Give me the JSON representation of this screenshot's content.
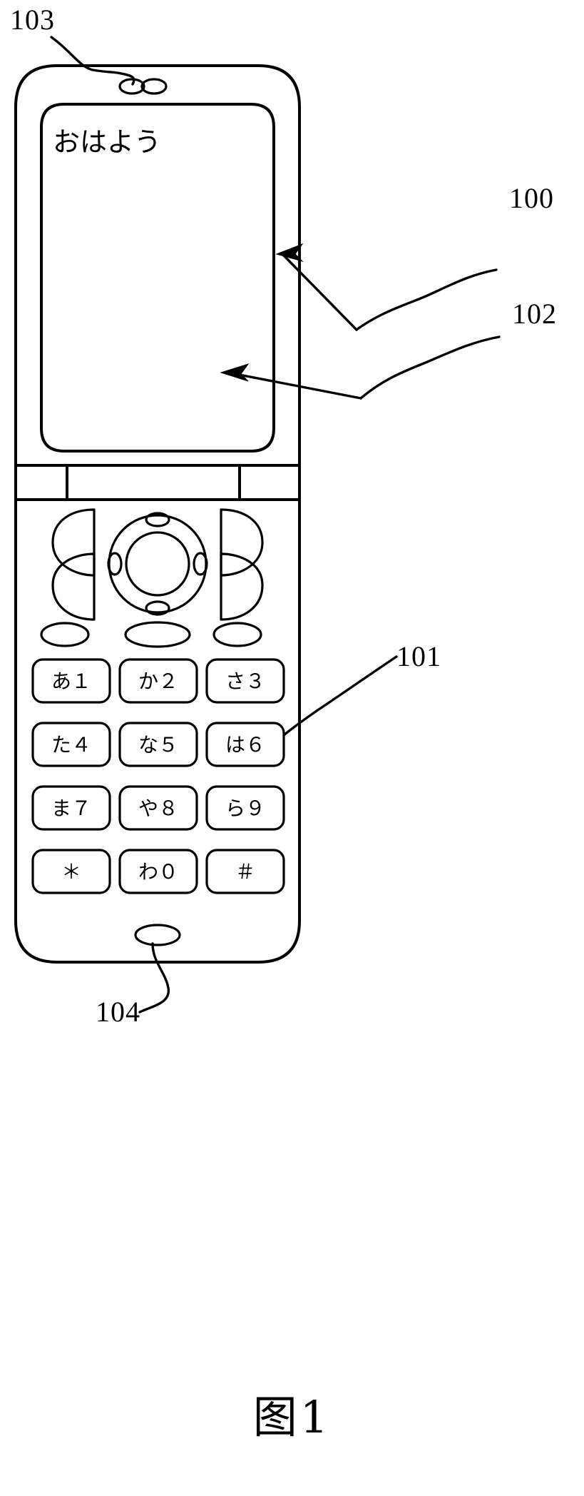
{
  "figure": {
    "caption": "图1",
    "subject": "folding mobile phone (flip phone) patent drawing"
  },
  "reference_numerals": [
    {
      "id": "103",
      "label": "103",
      "points_to": "earpiece-speaker-holes"
    },
    {
      "id": "100",
      "label": "100",
      "points_to": "phone-body"
    },
    {
      "id": "102",
      "label": "102",
      "points_to": "display-screen"
    },
    {
      "id": "101",
      "label": "101",
      "points_to": "keypad-key"
    },
    {
      "id": "104",
      "label": "104",
      "points_to": "microphone"
    }
  ],
  "display": {
    "text": "おはよう"
  },
  "keypad": {
    "rows": [
      [
        {
          "label": "あ１"
        },
        {
          "label": "か２"
        },
        {
          "label": "さ３"
        }
      ],
      [
        {
          "label": "た４"
        },
        {
          "label": "な５"
        },
        {
          "label": "は６"
        }
      ],
      [
        {
          "label": "ま７"
        },
        {
          "label": "や８"
        },
        {
          "label": "ら９"
        }
      ],
      [
        {
          "label": "＊"
        },
        {
          "label": "わ０"
        },
        {
          "label": "＃"
        }
      ]
    ]
  },
  "colors": {
    "ink": "#000000",
    "paper": "#ffffff"
  }
}
